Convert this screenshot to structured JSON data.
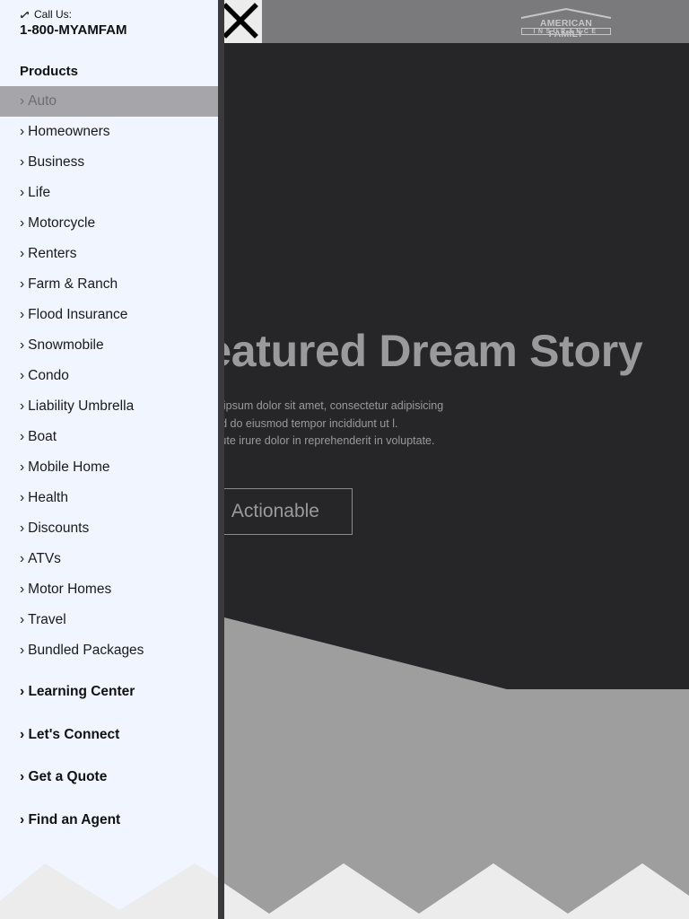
{
  "header": {
    "call_label": "Call Us:",
    "phone": "1-800-MYAMFAM",
    "brand_line1": "AMERICAN FAMILY",
    "brand_line2": "INSURANCE"
  },
  "drawer": {
    "products_heading": "Products",
    "items": [
      {
        "label": "Auto"
      },
      {
        "label": "Homeowners"
      },
      {
        "label": "Business"
      },
      {
        "label": "Life"
      },
      {
        "label": "Motorcycle"
      },
      {
        "label": "Renters"
      },
      {
        "label": "Farm & Ranch"
      },
      {
        "label": "Flood Insurance"
      },
      {
        "label": "Snowmobile"
      },
      {
        "label": "Condo"
      },
      {
        "label": "Liability Umbrella"
      },
      {
        "label": "Boat"
      },
      {
        "label": "Mobile Home"
      },
      {
        "label": "Health"
      },
      {
        "label": "Discounts"
      },
      {
        "label": "ATVs"
      },
      {
        "label": "Motor Homes"
      },
      {
        "label": "Travel"
      },
      {
        "label": "Bundled Packages"
      }
    ],
    "active_item": "Auto",
    "sections": [
      {
        "label": "Learning Center"
      },
      {
        "label": "Let's Connect"
      },
      {
        "label": "Get a Quote"
      },
      {
        "label": "Find an Agent"
      }
    ]
  },
  "hero": {
    "title": "Featured Dream Story",
    "line1": "Lorem ipsum dolor sit amet, consectetur adipisicing",
    "line2": "elit, sed do eiusmod tempor incididunt ut l.",
    "line3": "Duis aute irure dolor in reprehenderit in voluptate.",
    "button_label": "Actionable"
  },
  "colors": {
    "drawer_bg": "#f0f5ff",
    "active_item_bg": "#a6a6aa",
    "hero_bg": "#262628",
    "band_gray": "#9e9e9e"
  }
}
